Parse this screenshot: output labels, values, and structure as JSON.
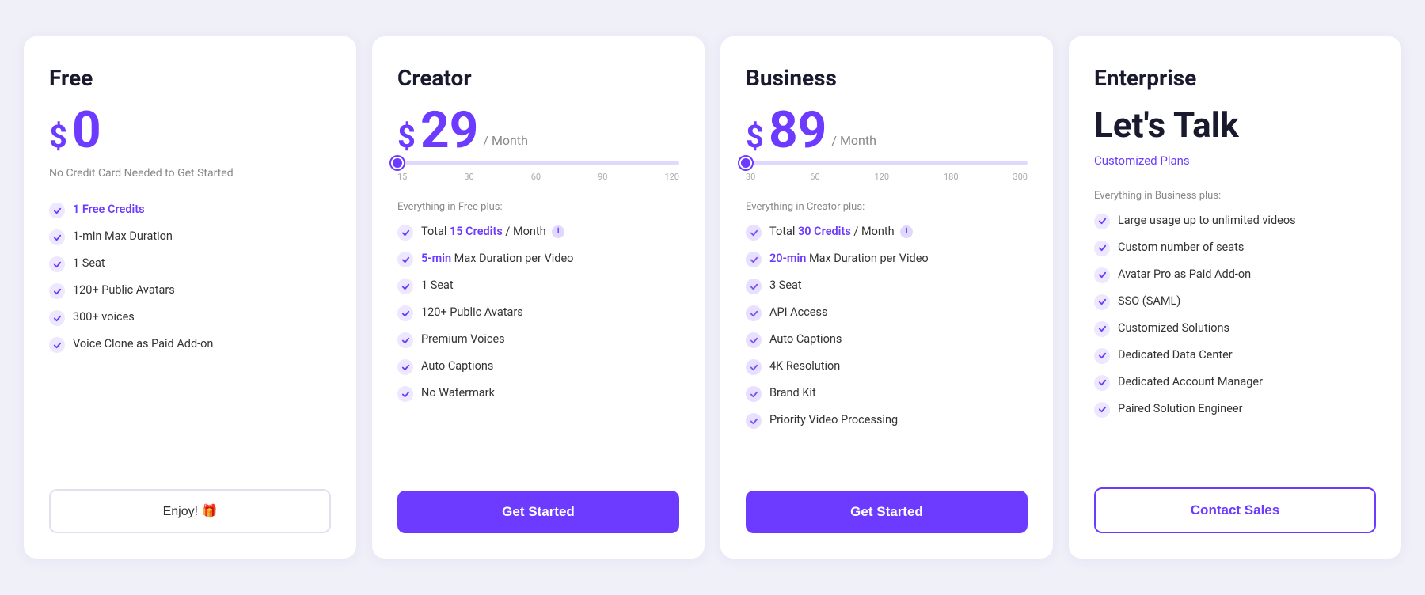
{
  "cards": {
    "free": {
      "title": "Free",
      "price": "$0",
      "price_dollar": "$",
      "price_number": "0",
      "price_note": "No Credit Card Needed to Get Started",
      "button_label": "Enjoy! 🎁",
      "features": [
        {
          "text": "1 Free Credits",
          "highlight": "1 Free Credits"
        },
        {
          "text": "1-min Max Duration",
          "highlight": ""
        },
        {
          "text": "1 Seat",
          "highlight": ""
        },
        {
          "text": "120+ Public Avatars",
          "highlight": ""
        },
        {
          "text": "300+ voices",
          "highlight": ""
        },
        {
          "text": "Voice Clone as Paid Add-on",
          "highlight": ""
        }
      ]
    },
    "creator": {
      "title": "Creator",
      "price_dollar": "$",
      "price_number": "29",
      "price_period": "/ Month",
      "slider_fill_pct": 0,
      "slider_labels": [
        "15",
        "30",
        "60",
        "90",
        "120"
      ],
      "section_label": "Everything in Free plus:",
      "button_label": "Get Started",
      "features": [
        {
          "text": "Total 15 Credits / Month",
          "highlight": "15 Credits",
          "info": true
        },
        {
          "text": "5-min Max Duration per Video",
          "highlight": "5-min"
        },
        {
          "text": "1 Seat",
          "highlight": ""
        },
        {
          "text": "120+ Public Avatars",
          "highlight": ""
        },
        {
          "text": "Premium Voices",
          "highlight": ""
        },
        {
          "text": "Auto Captions",
          "highlight": ""
        },
        {
          "text": "No Watermark",
          "highlight": ""
        }
      ]
    },
    "business": {
      "title": "Business",
      "price_dollar": "$",
      "price_number": "89",
      "price_period": "/ Month",
      "slider_fill_pct": 0,
      "slider_labels": [
        "30",
        "60",
        "120",
        "180",
        "300"
      ],
      "section_label": "Everything in Creator plus:",
      "button_label": "Get Started",
      "features": [
        {
          "text": "Total 30 Credits / Month",
          "highlight": "30 Credits",
          "info": true
        },
        {
          "text": "20-min Max Duration per Video",
          "highlight": "20-min"
        },
        {
          "text": "3 Seat",
          "highlight": ""
        },
        {
          "text": "API Access",
          "highlight": ""
        },
        {
          "text": "Auto Captions",
          "highlight": ""
        },
        {
          "text": "4K Resolution",
          "highlight": ""
        },
        {
          "text": "Brand Kit",
          "highlight": ""
        },
        {
          "text": "Priority Video Processing",
          "highlight": ""
        }
      ]
    },
    "enterprise": {
      "title": "Enterprise",
      "lets_talk": "Let's Talk",
      "customized_plans": "Customized Plans",
      "section_label": "Everything in Business plus:",
      "button_label": "Contact Sales",
      "features": [
        {
          "text": "Large usage up to unlimited videos",
          "highlight": ""
        },
        {
          "text": "Custom number of seats",
          "highlight": ""
        },
        {
          "text": "Avatar Pro as Paid Add-on",
          "highlight": ""
        },
        {
          "text": "SSO (SAML)",
          "highlight": ""
        },
        {
          "text": "Customized Solutions",
          "highlight": ""
        },
        {
          "text": "Dedicated Data Center",
          "highlight": ""
        },
        {
          "text": "Dedicated Account Manager",
          "highlight": ""
        },
        {
          "text": "Paired Solution Engineer",
          "highlight": ""
        }
      ]
    }
  }
}
